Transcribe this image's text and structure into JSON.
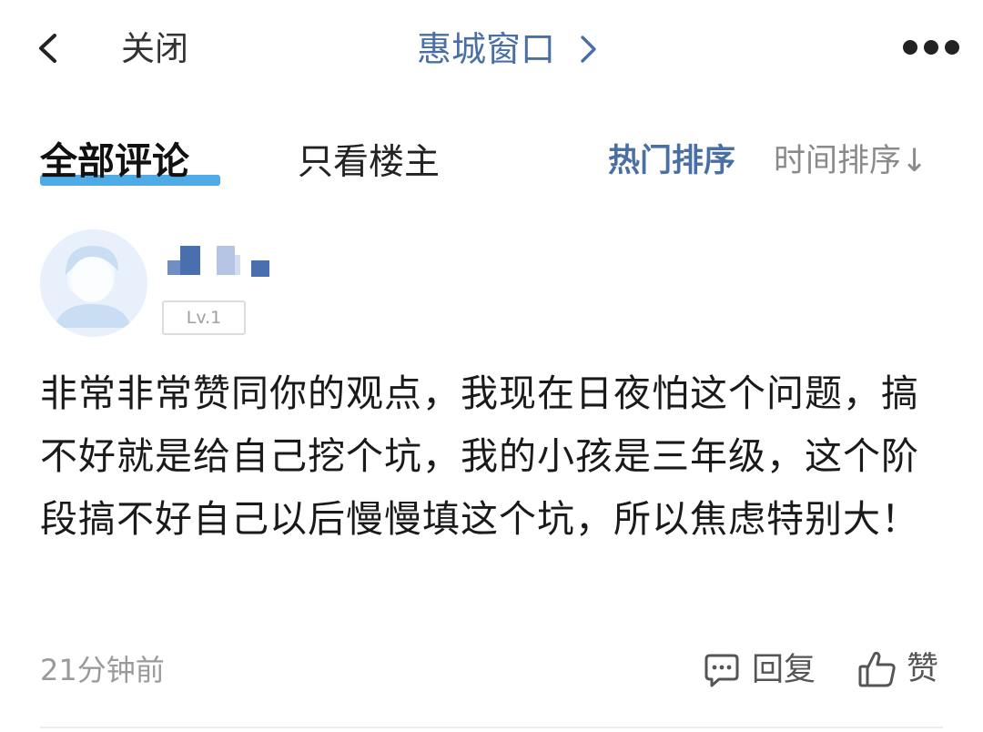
{
  "topbar": {
    "back_icon": "chevron-left-icon",
    "close_label": "关闭",
    "title": "惠城窗口",
    "title_icon": "chevron-right-icon",
    "more_icon": "more-dots-icon"
  },
  "tabs": {
    "all_comments": "全部评论",
    "owner_only": "只看楼主",
    "active": "all_comments"
  },
  "sort": {
    "hot": "热门排序",
    "time": "时间排序↓",
    "active": "hot"
  },
  "comment": {
    "avatar_icon": "default-avatar-icon",
    "username_icon": "pixelated-username",
    "level": "Lv.1",
    "body": "非常非常赞同你的观点，我现在日夜怕这个问题，搞不好就是给自己挖个坑，我的小孩是三年级，这个阶段搞不好自己以后慢慢填这个坑，所以焦虑特别大！",
    "time": "21分钟前",
    "reply_label": "回复",
    "reply_icon": "comment-bubble-icon",
    "like_label": "赞",
    "like_icon": "thumbs-up-icon"
  },
  "colors": {
    "accent": "#4a6fa5",
    "tab_underline": "#2f9ce0",
    "muted_text": "#9a9a9a",
    "body_text": "#1a1a1a"
  }
}
